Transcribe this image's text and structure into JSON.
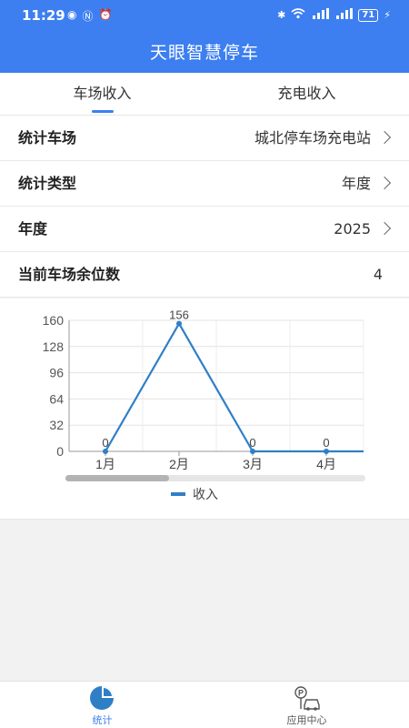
{
  "status_bar": {
    "time": "11:29",
    "battery": "71"
  },
  "header": {
    "title": "天眼智慧停车"
  },
  "tabs": [
    {
      "label": "车场收入",
      "active": true
    },
    {
      "label": "充电收入",
      "active": false
    }
  ],
  "filters": {
    "lot": {
      "label": "统计车场",
      "value": "城北停车场充电站"
    },
    "type": {
      "label": "统计类型",
      "value": "年度"
    },
    "year": {
      "label": "年度",
      "value": "2025"
    },
    "remaining": {
      "label": "当前车场余位数",
      "value": "4"
    }
  },
  "chart_data": {
    "type": "line",
    "categories": [
      "1月",
      "2月",
      "3月",
      "4月"
    ],
    "series": [
      {
        "name": "收入",
        "values": [
          0,
          156,
          0,
          0
        ],
        "color": "#2f7fc6"
      }
    ],
    "ylim": [
      0,
      160
    ],
    "yticks": [
      0,
      32,
      64,
      96,
      128,
      160
    ],
    "grid": true,
    "legend": "bottom",
    "scrollbar": true
  },
  "bottom_nav": [
    {
      "label": "统计",
      "icon": "pie-chart-icon",
      "active": true
    },
    {
      "label": "应用中心",
      "icon": "parking-car-icon",
      "active": false
    }
  ]
}
